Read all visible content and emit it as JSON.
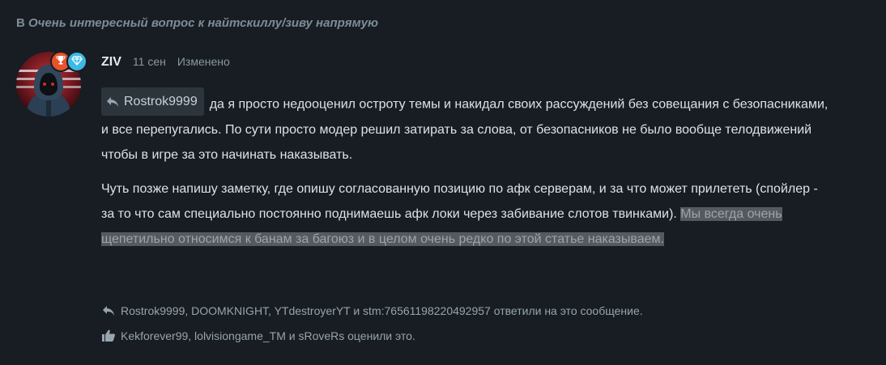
{
  "thread": {
    "prefix": "В",
    "title": "Очень интересный вопрос к найтскиллу/зиву напрямую"
  },
  "post": {
    "author": "ZIV",
    "date": "11 сен",
    "edited_label": "Изменено",
    "quote_user": "Rostrok9999",
    "paragraph1": "да я просто недооценил остроту темы и накидал своих рассуждений без совещания с безопасниками, и все перепугались. По сути просто модер решил затирать за слова, от безопасников не было вообще телодвижений чтобы в игре за это начинать наказывать.",
    "paragraph2_main": "Чуть позже напишу заметку, где опишу согласованную позицию по афк серверам, и за что может прилететь (спойлер - за то что сам специально постоянно поднимаешь афк локи через забивание слотов твинками).",
    "paragraph2_highlight": "Мы всегда очень щепетильно относимся к банам за багоюз и в целом очень редко по этой статье наказываем."
  },
  "footer": {
    "replies_text": "Rostrok9999, DOOMKNIGHT, YTdestroyerYT и stm:76561198220492957 ответили на это сообщение.",
    "likes_text": "Kekforever99, lolvisiongame_TM и sRoveRs оценили это."
  },
  "colors": {
    "background": "#171d22",
    "highlight_bg": "#545a5f",
    "badge_trophy": "#e8532a",
    "badge_diamond": "#3db9e5"
  },
  "icons": {
    "reply": "reply-arrow-icon",
    "like": "thumbs-up-icon",
    "trophy": "trophy-icon",
    "diamond": "diamond-icon"
  }
}
